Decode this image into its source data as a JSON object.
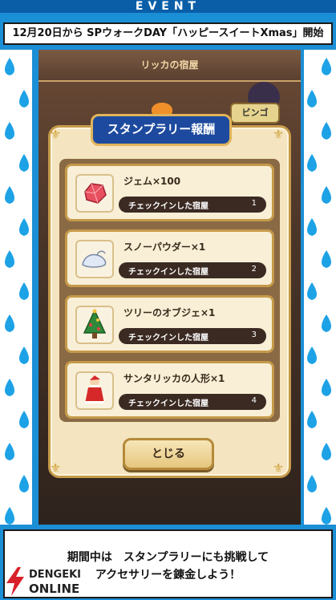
{
  "header": {
    "event_label": "EVENT",
    "announcement": "12月20日から SPウォークDAY「ハッピースイートXmas」開始"
  },
  "game": {
    "inn_title": "リッカの宿屋",
    "bingo_label": "ビンゴ",
    "dialog_title": "スタンプラリー報酬",
    "rewards": [
      {
        "name": "ジェム×100",
        "check_label": "チェックインした宿屋",
        "count": "1",
        "icon": "gem-icon"
      },
      {
        "name": "スノーパウダー×1",
        "check_label": "チェックインした宿屋",
        "count": "2",
        "icon": "snow-powder-icon"
      },
      {
        "name": "ツリーのオブジェ×1",
        "check_label": "チェックインした宿屋",
        "count": "3",
        "icon": "christmas-tree-icon"
      },
      {
        "name": "サンタリッカの人形×1",
        "check_label": "チェックインした宿屋",
        "count": "4",
        "icon": "santa-doll-icon"
      }
    ],
    "close_label": "とじる"
  },
  "caption": {
    "line1": "期間中は　スタンプラリーにも挑戦して",
    "line2": "アクセサリーを錬金しよう！"
  },
  "logo": {
    "line1": "DENGEKI",
    "line2": "ONLINE"
  },
  "colors": {
    "background_blue": "#1b8fd6",
    "dialog_header": "#1d4a9e",
    "frame_gold": "#c59a4a",
    "logo_red": "#d8202a"
  }
}
